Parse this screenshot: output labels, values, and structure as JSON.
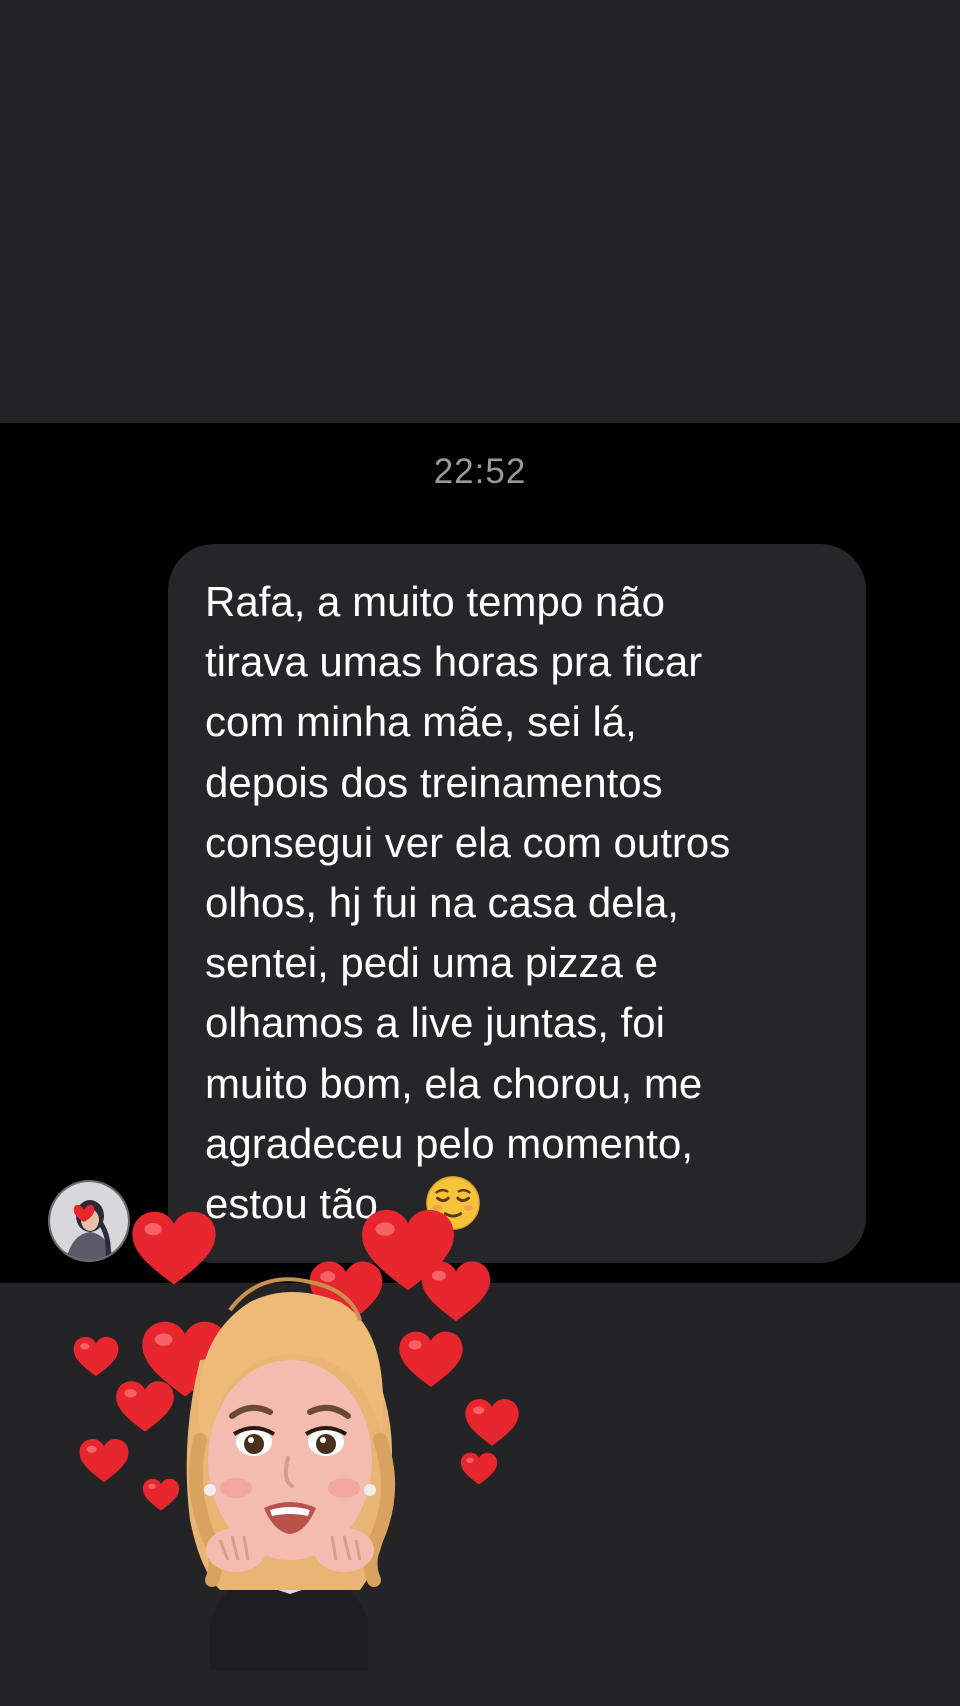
{
  "chat": {
    "timestamp": "22:52",
    "message": {
      "lines": [
        "Rafa, a muito tempo não",
        "tirava umas horas pra ficar",
        "com minha mãe, sei lá,",
        "depois dos treinamentos",
        "consegui ver ela com outros",
        "olhos, hj fui na casa dela,",
        "sentei, pedi uma pizza e",
        "olhamos a live juntas, foi",
        "muito bom, ela chorou, me",
        "agradeceu pelo momento,",
        "estou tão"
      ],
      "emoji": "relieved-face-emoji"
    },
    "avatar_icon": "profile-avatar",
    "sticker_icon": "memoji-hearts-sticker"
  },
  "colors": {
    "background_top": "#242426",
    "chat_background": "#000000",
    "bubble": "#262628",
    "text": "#ffffff",
    "timestamp": "#9a9a9e",
    "heart": "#e8262d"
  }
}
